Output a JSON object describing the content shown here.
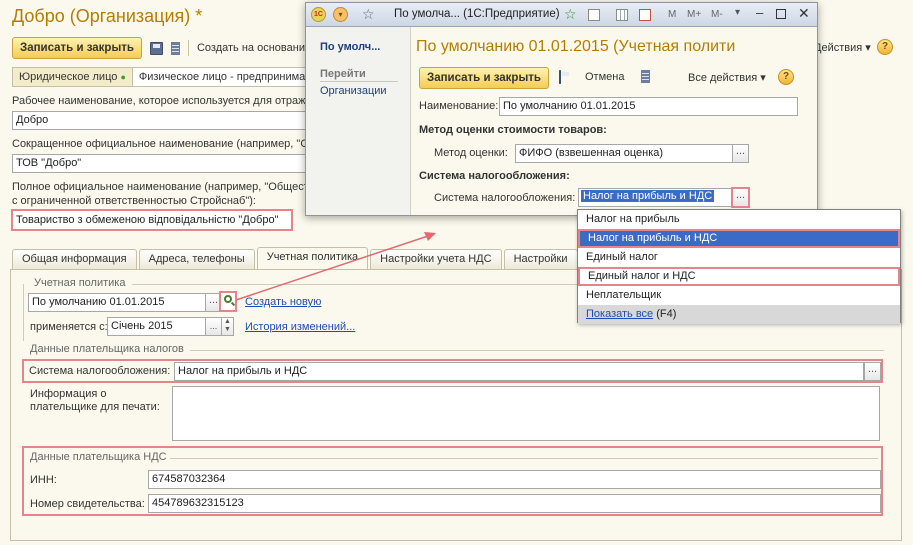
{
  "main": {
    "title": "Добро (Организация) *",
    "toolbar": {
      "save_label": "Записать и закрыть",
      "create_based": "Создать на основании",
      "all_actions": "Действия",
      "help": "?"
    },
    "entity_types": [
      "Юридическое лицо",
      "Физическое лицо - предприниматель"
    ],
    "working_name_label": "Рабочее наименование, которое используется для отражения в программе:",
    "working_name_value": "Добро",
    "short_name_label": "Сокращенное официальное наименование (например, \"ООО ...\"):",
    "short_name_value": "ТОВ \"Добро\"",
    "full_name_label_1": "Полное официальное наименование (например, \"Общество",
    "full_name_label_2": "с ограниченной ответственностью Стройснаб\"):",
    "full_name_value": "Товариство з обмеженою відповідальністю \"Добро\"",
    "tabs": [
      "Общая информация",
      "Адреса, телефоны",
      "Учетная политика",
      "Настройки учета НДС",
      "Настройки"
    ],
    "accounting_policy": {
      "group_title": "Учетная политика",
      "value": "По умолчанию 01.01.2015",
      "create_new": "Создать новую",
      "applies_label": "применяется с:",
      "applies_value": "Січень 2015",
      "history_link": "История изменений..."
    },
    "taxpayer": {
      "group_title": "Данные плательщика налогов",
      "tax_system_label": "Система налогообложения:",
      "tax_system_value": "Налог на прибыль и НДС",
      "print_info_label_1": "Информация о",
      "print_info_label_2": "плательщике для печати:"
    },
    "vat_payer": {
      "group_title": "Данные плательщика НДС",
      "inn_label": "ИНН:",
      "inn_value": "674587032364",
      "cert_label": "Номер свидетельства:",
      "cert_value": "454789632315123"
    }
  },
  "modal": {
    "window_title": "По умолча... (1С:Предприятие)",
    "toolbar_letters": [
      "M",
      "M+",
      "M-"
    ],
    "side_current": "По умолч...",
    "side_goto": "Перейти",
    "side_org": "Организации",
    "heading": "По умолчанию 01.01.2015 (Учетная полити",
    "save_label": "Записать и закрыть",
    "cancel_label": "Отмена",
    "all_actions": "Все действия",
    "help": "?",
    "name_label": "Наименование:",
    "name_value": "По умолчанию 01.01.2015",
    "valuation_section": "Метод оценки стоимости товаров:",
    "valuation_label": "Метод оценки:",
    "valuation_value": "ФИФО (взвешенная оценка)",
    "tax_section": "Система налогообложения:",
    "tax_label": "Система налогообложения:",
    "tax_value": "Налог на прибыль и НДС"
  },
  "dropdown": {
    "items": [
      "Налог на прибыль",
      "Налог на прибыль и НДС",
      "Единый налог",
      "Единый налог и НДС",
      "Неплательщик"
    ],
    "show_all": "Показать все",
    "show_all_hint": "(F4)"
  },
  "colors": {
    "accent_title": "#b57d00",
    "highlight_box": "#e5858a",
    "selection": "#3a6cc6",
    "link": "#1f4cb3"
  }
}
